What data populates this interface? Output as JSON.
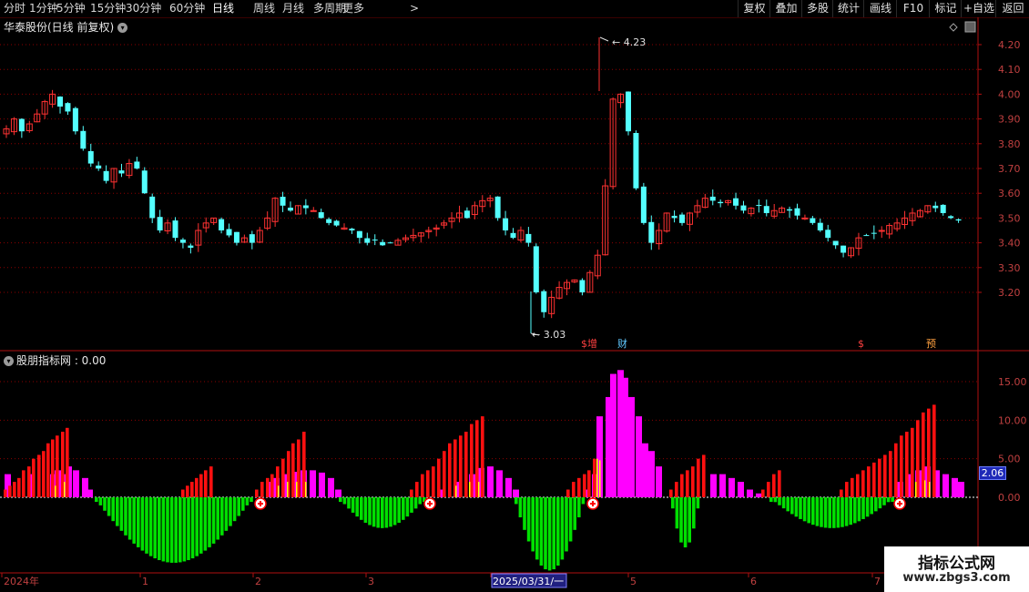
{
  "toolbar": {
    "periods": [
      {
        "label": "分时",
        "active": false
      },
      {
        "label": "1分钟",
        "active": false
      },
      {
        "label": "5分钟",
        "active": false
      },
      {
        "label": "15分钟",
        "active": false
      },
      {
        "label": "30分钟",
        "active": false
      },
      {
        "label": "60分钟",
        "active": false
      },
      {
        "label": "日线",
        "active": true
      },
      {
        "label": "周线",
        "active": false
      },
      {
        "label": "月线",
        "active": false
      },
      {
        "label": "多周期",
        "active": false
      },
      {
        "label": "更多",
        "active": false
      }
    ],
    "more_arrow": ">",
    "right_buttons": [
      "复权",
      "叠加",
      "多股",
      "统计",
      "画线",
      "F10",
      "标记",
      "+自选",
      "返回"
    ]
  },
  "main_panel": {
    "title": "华泰股份(日线 前复权)",
    "y_ticks": [
      "4.20",
      "4.10",
      "4.00",
      "3.90",
      "3.80",
      "3.70",
      "3.60",
      "3.50",
      "3.40",
      "3.30",
      "3.20"
    ],
    "high_label": "4.23",
    "low_label": "3.03",
    "event_markers": [
      {
        "text": "$增",
        "color": "#ff4040"
      },
      {
        "text": "财",
        "color": "#60c8ff"
      },
      {
        "text": "$",
        "color": "#ff4040"
      },
      {
        "text": "预",
        "color": "#ffa040"
      }
    ]
  },
  "sub_panel": {
    "title": "股朋指标网 : 0.00",
    "y_ticks": [
      "15.00",
      "10.00",
      "5.00",
      "0.00"
    ],
    "current_value": "2.06"
  },
  "x_axis": {
    "labels": [
      "2024年",
      "1",
      "2",
      "3",
      "2025/03/31/一",
      "5",
      "6",
      "7"
    ]
  },
  "watermark": {
    "line1": "指标公式网",
    "line2": "www.zbgs3.com"
  },
  "colors": {
    "up": "#ff3232",
    "down": "#54ffff",
    "grid": "#8b0000",
    "green": "#00e000",
    "magenta": "#ff00ff",
    "red_bar": "#ff1010",
    "yellow": "#ffff00"
  },
  "chart_data": {
    "type": "candlestick",
    "symbol": "华泰股份",
    "price_range": [
      3.03,
      4.23
    ],
    "closes": [
      3.86,
      3.9,
      3.85,
      3.88,
      3.92,
      3.97,
      4.0,
      3.95,
      3.93,
      3.85,
      3.78,
      3.72,
      3.7,
      3.65,
      3.7,
      3.68,
      3.72,
      3.7,
      3.6,
      3.5,
      3.45,
      3.48,
      3.42,
      3.4,
      3.38,
      3.45,
      3.48,
      3.5,
      3.45,
      3.43,
      3.4,
      3.42,
      3.4,
      3.45,
      3.5,
      3.58,
      3.55,
      3.53,
      3.55,
      3.54,
      3.53,
      3.5,
      3.48,
      3.47,
      3.46,
      3.45,
      3.42,
      3.4,
      3.41,
      3.39,
      3.4,
      3.41,
      3.42,
      3.43,
      3.44,
      3.45,
      3.46,
      3.48,
      3.5,
      3.52,
      3.5,
      3.55,
      3.57,
      3.58,
      3.5,
      3.45,
      3.42,
      3.45,
      3.4,
      3.2,
      3.12,
      3.18,
      3.22,
      3.24,
      3.25,
      3.2,
      3.28,
      3.35,
      3.63,
      3.98,
      4.0,
      3.85,
      3.62,
      3.48,
      3.4,
      3.45,
      3.52,
      3.5,
      3.48,
      3.52,
      3.55,
      3.58,
      3.57,
      3.56,
      3.57,
      3.55,
      3.53,
      3.54,
      3.55,
      3.52,
      3.53,
      3.54,
      3.53,
      3.51,
      3.5,
      3.48,
      3.45,
      3.42,
      3.39,
      3.36,
      3.38,
      3.42,
      3.43,
      3.44,
      3.45,
      3.47,
      3.48,
      3.5,
      3.52,
      3.53,
      3.55,
      3.54,
      3.52,
      3.5,
      3.49
    ],
    "indicator": {
      "red_bars": "positive red histogram",
      "magenta_area": "positive magenta area",
      "green_bars": "negative green histogram",
      "peak": 16.5,
      "trough": -9.3
    }
  }
}
